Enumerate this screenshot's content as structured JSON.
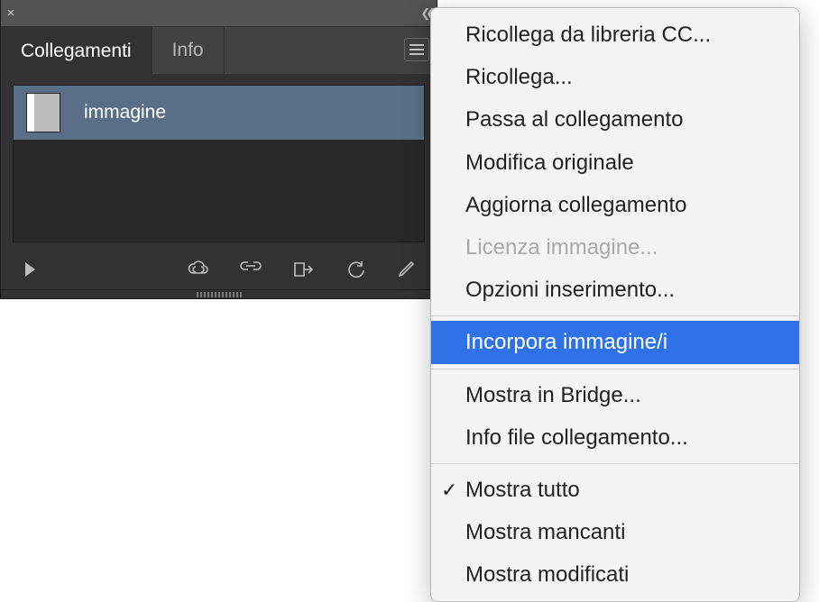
{
  "panel": {
    "tabs": [
      {
        "label": "Collegamenti",
        "active": true
      },
      {
        "label": "Info",
        "active": false
      }
    ],
    "items": [
      {
        "label": "immagine"
      }
    ],
    "footer_icons": [
      "expand",
      "cloud-link",
      "link",
      "goto",
      "refresh",
      "edit"
    ]
  },
  "menu": {
    "groups": [
      [
        {
          "label": "Ricollega da libreria CC...",
          "enabled": true
        },
        {
          "label": "Ricollega...",
          "enabled": true
        },
        {
          "label": "Passa al collegamento",
          "enabled": true
        },
        {
          "label": "Modifica originale",
          "enabled": true
        },
        {
          "label": "Aggiorna collegamento",
          "enabled": true
        },
        {
          "label": "Licenza immagine...",
          "enabled": false
        },
        {
          "label": "Opzioni inserimento...",
          "enabled": true
        }
      ],
      [
        {
          "label": "Incorpora immagine/i",
          "enabled": true,
          "highlight": true
        }
      ],
      [
        {
          "label": "Mostra in Bridge...",
          "enabled": true
        },
        {
          "label": "Info file collegamento...",
          "enabled": true
        }
      ],
      [
        {
          "label": "Mostra tutto",
          "enabled": true,
          "checked": true
        },
        {
          "label": "Mostra mancanti",
          "enabled": true
        },
        {
          "label": "Mostra modificati",
          "enabled": true
        }
      ]
    ]
  }
}
